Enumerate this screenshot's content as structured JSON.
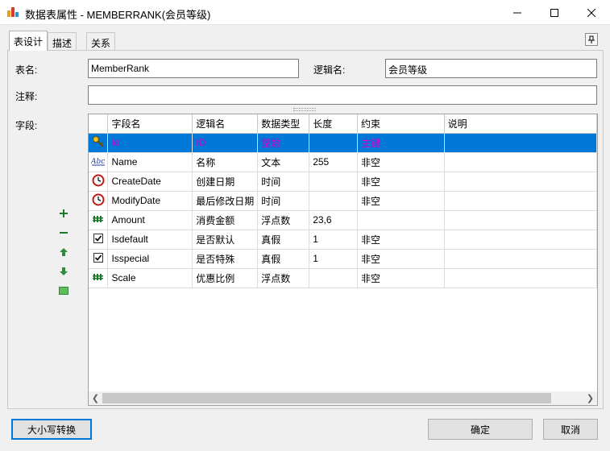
{
  "window": {
    "title": "数据表属性 - MEMBERRANK(会员等级)"
  },
  "tabs": [
    {
      "label": "表设计",
      "active": true
    },
    {
      "label": "描述",
      "active": false
    },
    {
      "label": "关系",
      "active": false
    }
  ],
  "form": {
    "table_name_label": "表名:",
    "table_name_value": "MemberRank",
    "logical_name_label": "逻辑名:",
    "logical_name_value": "会员等级",
    "comment_label": "注释:",
    "comment_value": "",
    "fields_label": "字段:"
  },
  "grid": {
    "columns": [
      "字段名",
      "逻辑名",
      "数据类型",
      "长度",
      "约束",
      "说明"
    ],
    "rows": [
      {
        "icon": "key-icon",
        "name": "Id",
        "logical": "ID",
        "type": "整数",
        "length": "",
        "constraint": "主键",
        "note": "",
        "selected": true
      },
      {
        "icon": "text-type-icon",
        "name": "Name",
        "logical": "名称",
        "type": "文本",
        "length": "255",
        "constraint": "非空",
        "note": ""
      },
      {
        "icon": "clock-icon",
        "name": "CreateDate",
        "logical": "创建日期",
        "type": "时间",
        "length": "",
        "constraint": "非空",
        "note": ""
      },
      {
        "icon": "clock-icon",
        "name": "ModifyDate",
        "logical": "最后修改日期",
        "type": "时间",
        "length": "",
        "constraint": "非空",
        "note": ""
      },
      {
        "icon": "decimal-type-icon",
        "name": "Amount",
        "logical": "消费金额",
        "type": "浮点数",
        "length": "23,6",
        "constraint": "",
        "note": ""
      },
      {
        "icon": "checkbox-icon",
        "name": "Isdefault",
        "logical": "是否默认",
        "type": "真假",
        "length": "1",
        "constraint": "非空",
        "note": ""
      },
      {
        "icon": "checkbox-icon",
        "name": "Isspecial",
        "logical": "是否特殊",
        "type": "真假",
        "length": "1",
        "constraint": "非空",
        "note": ""
      },
      {
        "icon": "decimal-type-icon",
        "name": "Scale",
        "logical": "优惠比例",
        "type": "浮点数",
        "length": "",
        "constraint": "非空",
        "note": ""
      }
    ]
  },
  "buttons": {
    "case_convert": "大小写转换",
    "ok": "确定",
    "cancel": "取消"
  },
  "colors": {
    "selection": "#0078d7",
    "selected_text": "#d000d0",
    "add_icon": "#1a7a2a",
    "up_down_icon": "#2e8b3e"
  }
}
